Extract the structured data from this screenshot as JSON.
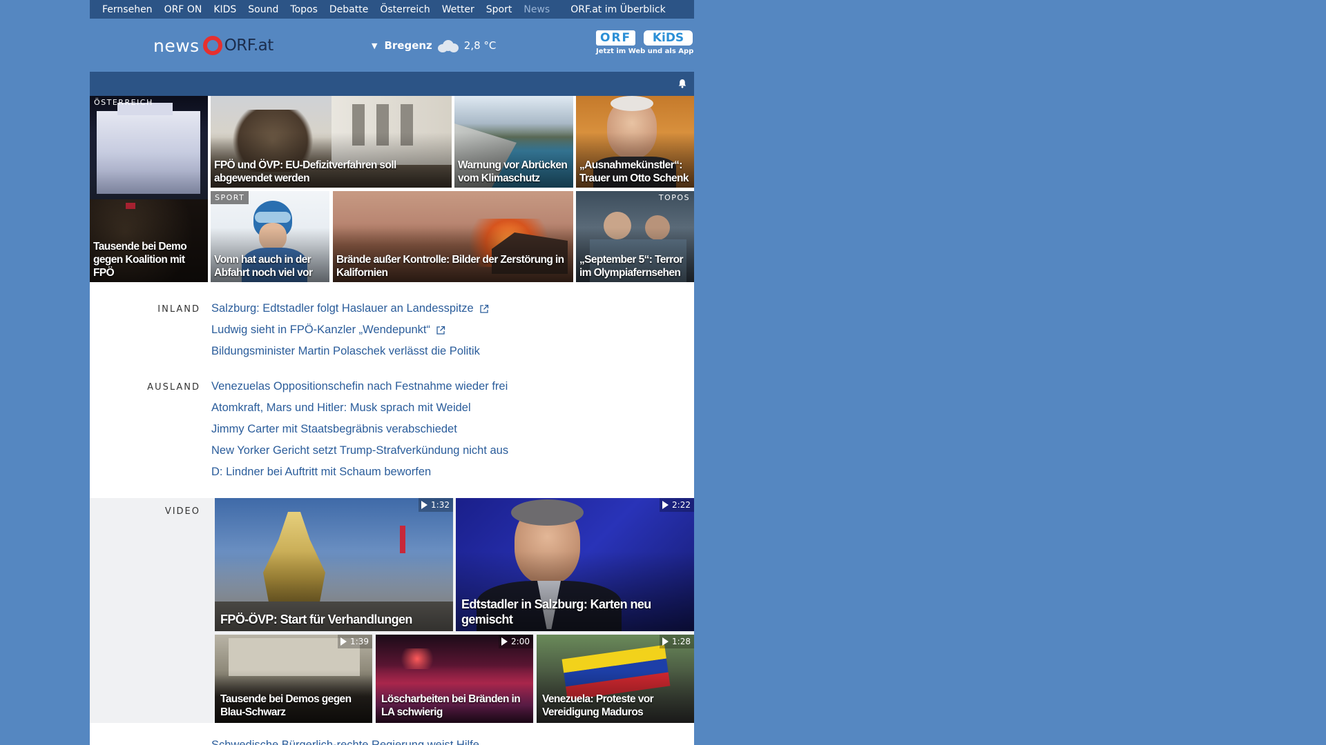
{
  "nav": {
    "items": [
      "Fernsehen",
      "ORF ON",
      "KIDS",
      "Sound",
      "Topos",
      "Debatte",
      "Österreich",
      "Wetter",
      "Sport",
      "News"
    ],
    "active": "News",
    "overview": "ORF.at im Überblick"
  },
  "header": {
    "logo_news": "news",
    "logo_orf": "ORF.at",
    "weather": {
      "city": "Bregenz",
      "temp": "2,8 °C",
      "icon": "cloud-icon"
    },
    "kids_promo": {
      "badge1": "ORF",
      "badge2": "KiDS",
      "tagline": "Jetzt im Web und als App"
    }
  },
  "tiles": [
    {
      "label": "ÖSTERREICH",
      "caption": "Tausende bei Demo gegen Koalition mit FPÖ"
    },
    {
      "label": "",
      "caption": "FPÖ und ÖVP: EU-Defizitverfahren soll abgewendet werden"
    },
    {
      "label": "",
      "caption": "Warnung vor Abrücken vom Klimaschutz"
    },
    {
      "label": "",
      "caption": "„Ausnahmekünstler“: Trauer um Otto Schenk"
    },
    {
      "label": "SPORT",
      "caption": "Vonn hat auch in der Abfahrt noch viel vor"
    },
    {
      "label": "",
      "caption": "Brände außer Kontrolle: Bilder der Zerstörung in Kalifornien"
    },
    {
      "label": "TOPOS",
      "caption": "„September 5“: Terror im Olympiafernsehen"
    }
  ],
  "sections": {
    "inland": {
      "label": "INLAND",
      "headlines": [
        "Salzburg: Edtstadler folgt Haslauer an Landesspitze",
        "Ludwig sieht in FPÖ-Kanzler „Wendepunkt“",
        "Bildungsminister Martin Polaschek verlässt die Politik"
      ]
    },
    "ausland": {
      "label": "AUSLAND",
      "headlines": [
        "Venezuelas Oppositionschefin nach Festnahme wieder frei",
        "Atomkraft, Mars und Hitler: Musk sprach mit Weidel",
        "Jimmy Carter mit Staatsbegräbnis verabschiedet",
        "New Yorker Gericht setzt Trump-Strafverkündung nicht aus",
        "D: Lindner bei Auftritt mit Schaum beworfen"
      ]
    },
    "video": {
      "label": "VIDEO",
      "items": [
        {
          "duration": "1:32",
          "caption": "FPÖ-ÖVP: Start für Verhandlungen"
        },
        {
          "duration": "2:22",
          "caption": "Edtstadler in Salzburg: Karten neu gemischt"
        },
        {
          "duration": "1:39",
          "caption": "Tausende bei Demos gegen Blau-Schwarz"
        },
        {
          "duration": "2:00",
          "caption": "Löscharbeiten bei Bränden in LA schwierig"
        },
        {
          "duration": "1:28",
          "caption": "Venezuela: Proteste vor Vereidigung Maduros"
        }
      ]
    }
  },
  "cutoff_headline": "Schwedische Bürgerlich-rechte Regierung weist Hilfe..."
}
